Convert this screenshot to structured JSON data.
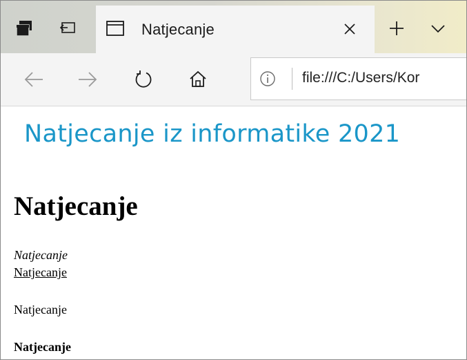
{
  "browser": {
    "tab": {
      "title": "Natjecanje"
    },
    "address": {
      "url": "file:///C:/Users/Kor"
    }
  },
  "page": {
    "banner": "Natjecanje iz informatike 2021",
    "heading": "Natjecanje",
    "italic_text": "Natjecanje",
    "underline_text": "Natjecanje",
    "plain_text": "Natjecanje",
    "bold_text": "Natjecanje"
  },
  "icons": {
    "tab_actions": "tab-actions-icon",
    "set_aside_tabs": "set-aside-tabs-icon",
    "page": "page-icon",
    "close_tab": "close-icon",
    "new_tab": "plus-icon",
    "tab_list": "chevron-down-icon",
    "back": "back-arrow-icon",
    "forward": "forward-arrow-icon",
    "refresh": "refresh-icon",
    "home": "home-icon",
    "info": "info-icon"
  },
  "colors": {
    "banner_text": "#1a96c8",
    "tab_background": "#f4f4f4",
    "toolbar_background": "#f4f4f4"
  }
}
